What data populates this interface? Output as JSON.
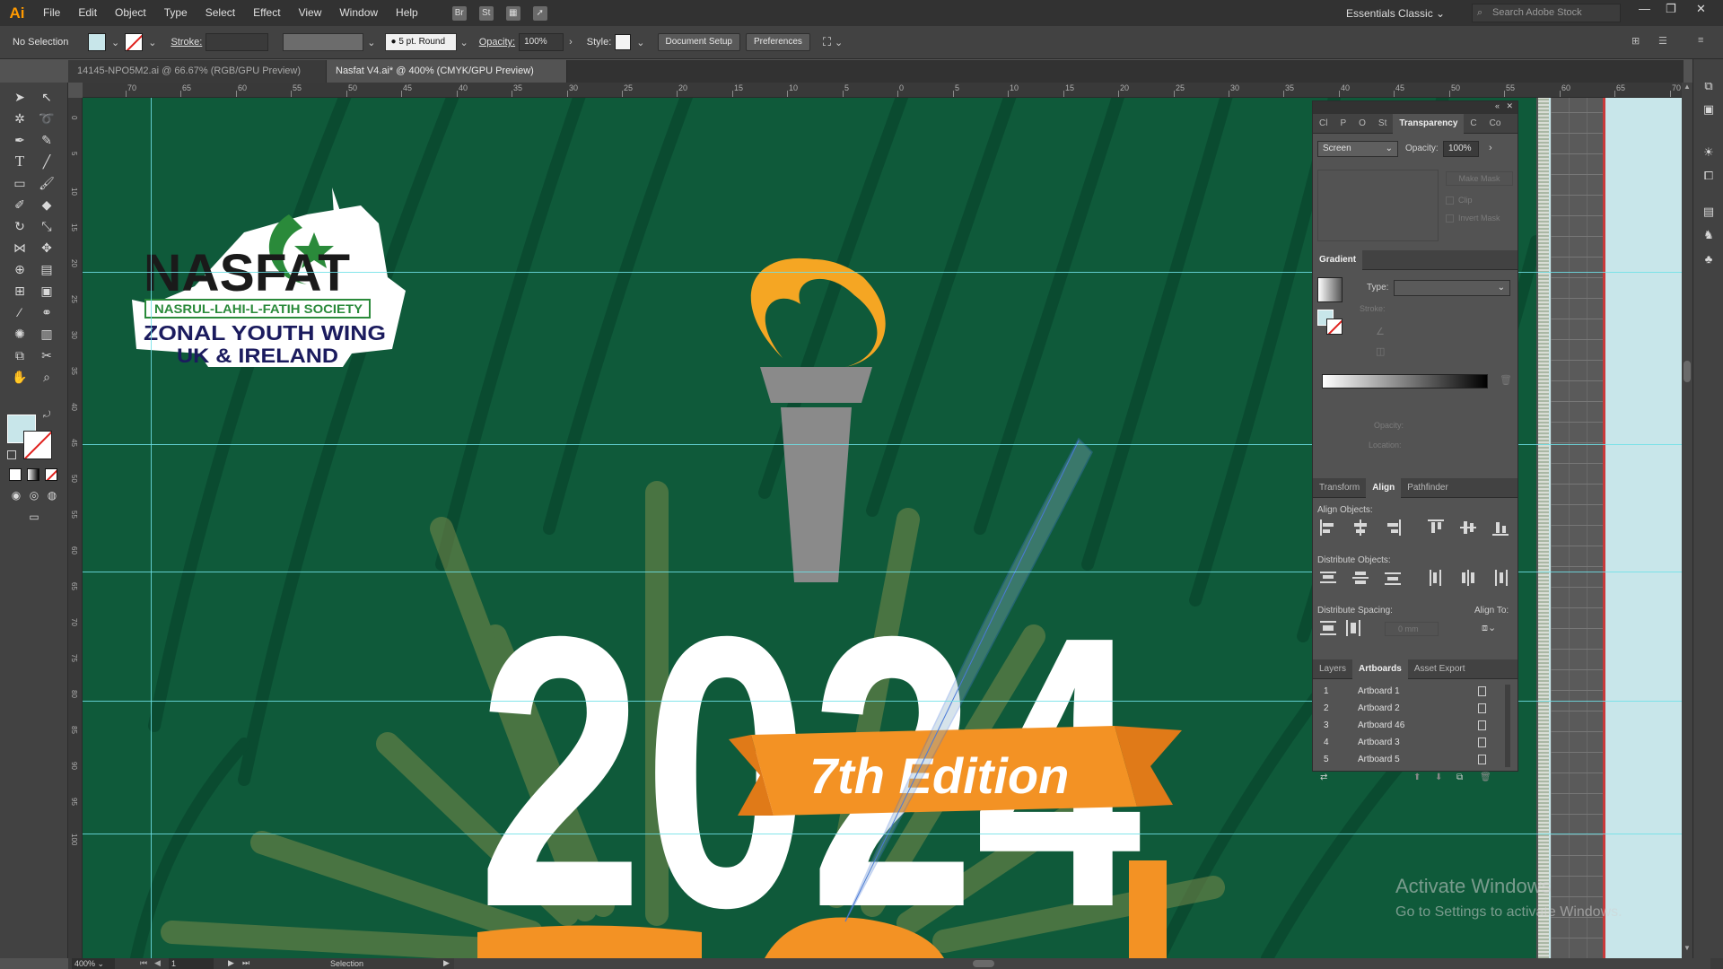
{
  "app": {
    "logo": "Ai",
    "menu": [
      "File",
      "Edit",
      "Object",
      "Type",
      "Select",
      "Effect",
      "View",
      "Window",
      "Help"
    ],
    "workspace": "Essentials Classic",
    "search_placeholder": "Search Adobe Stock"
  },
  "control_bar": {
    "selection": "No Selection",
    "stroke_label": "Stroke:",
    "brush": "5 pt. Round",
    "opacity_label": "Opacity:",
    "opacity_value": "100%",
    "style_label": "Style:",
    "document_setup": "Document Setup",
    "preferences": "Preferences"
  },
  "tabs": [
    {
      "label": "14145-NPO5M2.ai @ 66.67% (RGB/GPU Preview)",
      "active": false
    },
    {
      "label": "Nasfat V4.ai* @ 400% (CMYK/GPU Preview)",
      "active": true
    }
  ],
  "ruler": {
    "top": [
      "70",
      "65",
      "60",
      "55",
      "50",
      "45",
      "40",
      "35",
      "30",
      "25",
      "20",
      "15",
      "10",
      "5",
      "0",
      "5",
      "10",
      "15",
      "20",
      "25",
      "30",
      "35",
      "40",
      "45",
      "50",
      "55",
      "60",
      "65",
      "70"
    ]
  },
  "artwork": {
    "logo_word": "NASFAT",
    "logo_society": "NASRUL-LAHI-L-FATIH SOCIETY",
    "logo_line1": "ZONAL YOUTH WING",
    "logo_line2": "UK & IRELAND",
    "year": "2024",
    "edition": "7th Edition",
    "colors": {
      "background": "#0f5a3a",
      "orange": "#f39224",
      "flame": "#f5a623",
      "torch": "#8a8a8a"
    }
  },
  "panels": {
    "transparency": {
      "tabs": [
        "Cl",
        "P",
        "O",
        "St",
        "Transparency",
        "C",
        "Co"
      ],
      "blend_mode": "Screen",
      "opacity_label": "Opacity:",
      "opacity_value": "100%",
      "make_mask": "Make Mask",
      "clip": "Clip",
      "invert_mask": "Invert Mask"
    },
    "gradient": {
      "title": "Gradient",
      "type_label": "Type:",
      "stroke_label": "Stroke:",
      "opacity_label": "Opacity:",
      "location_label": "Location:"
    },
    "align": {
      "tabs": [
        "Transform",
        "Align",
        "Pathfinder"
      ],
      "align_objects": "Align Objects:",
      "distribute_objects": "Distribute Objects:",
      "distribute_spacing": "Distribute Spacing:",
      "align_to": "Align To:",
      "spacing_value": "0 mm"
    },
    "artboards": {
      "tabs": [
        "Layers",
        "Artboards",
        "Asset Export"
      ],
      "rows": [
        {
          "num": "1",
          "name": "Artboard 1"
        },
        {
          "num": "2",
          "name": "Artboard 2"
        },
        {
          "num": "3",
          "name": "Artboard 46"
        },
        {
          "num": "4",
          "name": "Artboard 3"
        },
        {
          "num": "5",
          "name": "Artboard 5"
        }
      ]
    }
  },
  "status": {
    "zoom": "400%",
    "artboard_number": "1",
    "tool": "Selection"
  },
  "watermark": {
    "line1": "Activate Windows",
    "line2": "Go to Settings to activate Windows."
  }
}
